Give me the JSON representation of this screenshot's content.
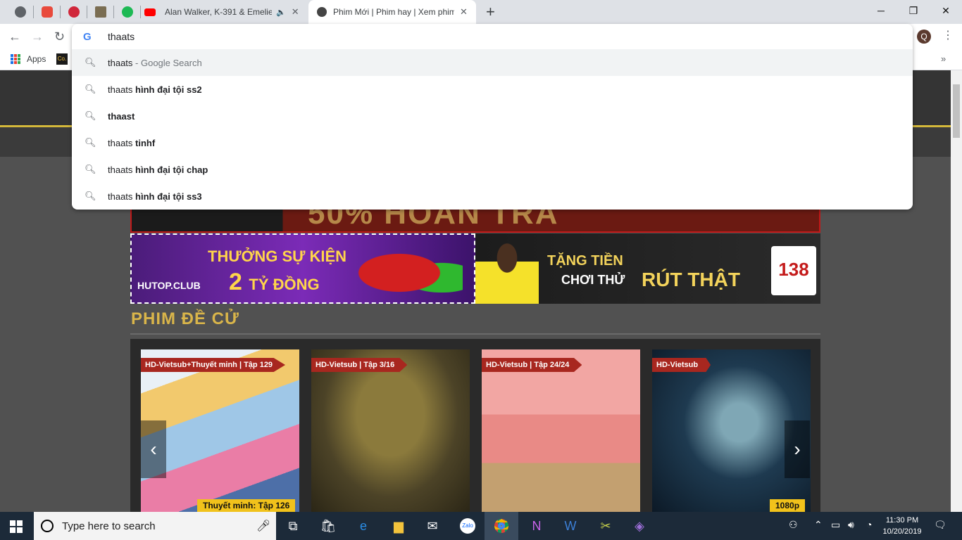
{
  "tabs": [
    {
      "title": "",
      "icon": "globe-icon"
    },
    {
      "title": "",
      "icon": "heart-icon"
    },
    {
      "title": "",
      "icon": "rose-icon"
    },
    {
      "title": "",
      "icon": "image-icon"
    },
    {
      "title": "",
      "icon": "podcast-icon"
    },
    {
      "title": "Alan Walker, K-391 & Emelie",
      "icon": "youtube-icon",
      "audio": "speaker-icon"
    },
    {
      "title": "Phim Mới | Phim hay | Xem phim",
      "icon": "film-reel-icon"
    }
  ],
  "omnibox": {
    "value": "thaats",
    "suggestions": [
      {
        "prefix": "thaats",
        "bold": "",
        "suffix": " - Google Search"
      },
      {
        "prefix": "thaats ",
        "bold": "hình đại tội ss2",
        "suffix": ""
      },
      {
        "prefix": "",
        "bold": "thaast",
        "suffix": ""
      },
      {
        "prefix": "thaats ",
        "bold": "tinhf",
        "suffix": ""
      },
      {
        "prefix": "thaats ",
        "bold": "hình đại tội chap",
        "suffix": ""
      },
      {
        "prefix": "thaats ",
        "bold": "hình đại tội ss3",
        "suffix": ""
      }
    ]
  },
  "bookmarks": {
    "apps_label": "Apps",
    "item1": "Co."
  },
  "profile_initial": "Q",
  "banners": {
    "b2a_line1": "THƯỞNG SỰ KIỆN",
    "b2a_num": "2",
    "b2a_line2": "TỶ ĐỒNG",
    "b2a_logo": "HUTOP.CLUB",
    "b2b_line1": "TẶNG TIỀN",
    "b2b_line2": "CHƠI THỬ",
    "b2b_line3": "RÚT THẬT",
    "b2b_logo": "138"
  },
  "section_title": "PHIM ĐỀ CỬ",
  "movies": [
    {
      "label": "HD-Vietsub+Thuyết minh | Tập 129",
      "badge": "Thuyết minh: Tập 126"
    },
    {
      "label": "HD-Vietsub | Tập 3/16",
      "badge": ""
    },
    {
      "label": "HD-Vietsub | Tập 24/24",
      "badge": ""
    },
    {
      "label": "HD-Vietsub",
      "badge": "1080p"
    }
  ],
  "taskbar": {
    "search_placeholder": "Type here to search",
    "time": "11:30 PM",
    "date": "10/20/2019"
  }
}
